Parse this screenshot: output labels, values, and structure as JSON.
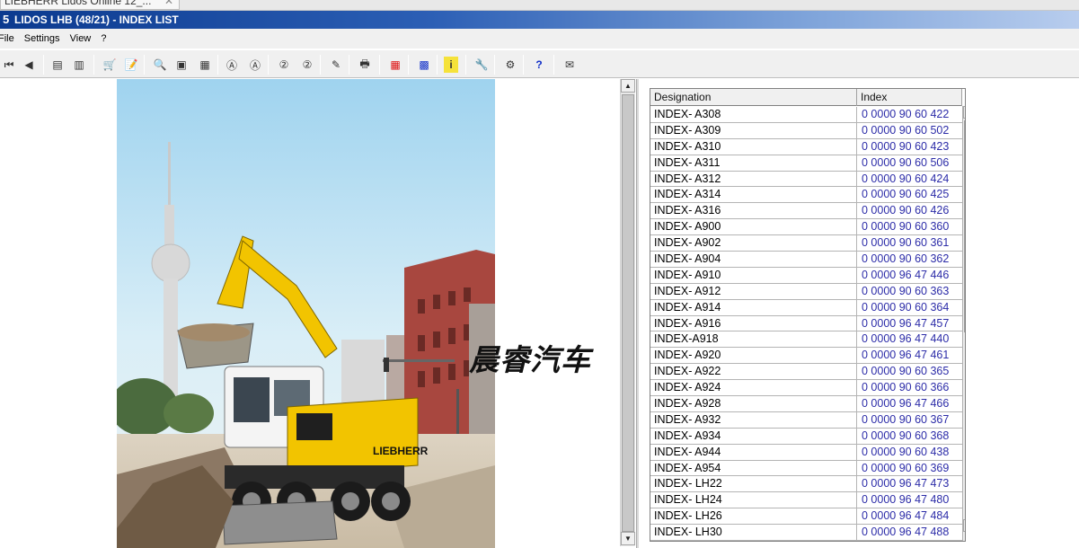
{
  "browser_tab": {
    "label": "LIEBHERR Lidos Online 12_..."
  },
  "window": {
    "title": "LIDOS LHB (48/21) - INDEX LIST",
    "icon": "lidos-app-icon"
  },
  "menu": {
    "items": [
      "File",
      "Settings",
      "View",
      "?"
    ]
  },
  "toolbar": {
    "buttons": [
      {
        "name": "first-page-icon",
        "glyph": "⏮"
      },
      {
        "name": "previous-icon",
        "glyph": "◀"
      },
      {
        "name": "page-back-icon",
        "glyph": "▤"
      },
      {
        "name": "page-forward-icon",
        "glyph": "▥"
      },
      {
        "name": "cart-icon",
        "glyph": "🛒"
      },
      {
        "name": "edit-list-icon",
        "glyph": "📝"
      },
      {
        "name": "zoom-in-icon",
        "glyph": "🔍"
      },
      {
        "name": "fit-page-icon",
        "glyph": "▣"
      },
      {
        "name": "fit-width-icon",
        "glyph": "▦"
      },
      {
        "name": "annotation-a-icon",
        "glyph": "Ⓐ"
      },
      {
        "name": "annotation-a-off-icon",
        "glyph": "Ⓐ"
      },
      {
        "name": "annotation-2-icon",
        "glyph": "②"
      },
      {
        "name": "annotation-2-off-icon",
        "glyph": "②"
      },
      {
        "name": "notes-icon",
        "glyph": "✎"
      },
      {
        "name": "print-icon",
        "glyph": "🖶"
      },
      {
        "name": "grid-icon",
        "glyph": "▦"
      },
      {
        "name": "table-icon",
        "glyph": "▩"
      },
      {
        "name": "info-icon",
        "glyph": "i"
      },
      {
        "name": "tools-icon",
        "glyph": "🔧"
      },
      {
        "name": "parts-icon",
        "glyph": "⚙"
      },
      {
        "name": "lidos-help-icon",
        "glyph": "?"
      },
      {
        "name": "mail-icon",
        "glyph": "✉"
      }
    ]
  },
  "watermark": {
    "text": "晨睿汽车"
  },
  "index_list": {
    "columns": [
      "Designation",
      "Index"
    ],
    "rows": [
      [
        "INDEX- A308",
        "0 0000 90 60 422"
      ],
      [
        "INDEX- A309",
        "0 0000 90 60 502"
      ],
      [
        "INDEX- A310",
        "0 0000 90 60 423"
      ],
      [
        "INDEX- A311",
        "0 0000 90 60 506"
      ],
      [
        "INDEX- A312",
        "0 0000 90 60 424"
      ],
      [
        "INDEX- A314",
        "0 0000 90 60 425"
      ],
      [
        "INDEX- A316",
        "0 0000 90 60 426"
      ],
      [
        "INDEX- A900",
        "0 0000 90 60 360"
      ],
      [
        "INDEX- A902",
        "0 0000 90 60 361"
      ],
      [
        "INDEX- A904",
        "0 0000 90 60 362"
      ],
      [
        "INDEX- A910",
        "0 0000 96 47 446"
      ],
      [
        "INDEX- A912",
        "0 0000 90 60 363"
      ],
      [
        "INDEX- A914",
        "0 0000 90 60 364"
      ],
      [
        "INDEX- A916",
        "0 0000 96 47 457"
      ],
      [
        "INDEX-A918",
        "0 0000 96 47 440"
      ],
      [
        "INDEX- A920",
        "0 0000 96 47 461"
      ],
      [
        "INDEX- A922",
        "0 0000 90 60 365"
      ],
      [
        "INDEX- A924",
        "0 0000 90 60 366"
      ],
      [
        "INDEX- A928",
        "0 0000 96 47 466"
      ],
      [
        "INDEX- A932",
        "0 0000 90 60 367"
      ],
      [
        "INDEX- A934",
        "0 0000 90 60 368"
      ],
      [
        "INDEX- A944",
        "0 0000 90 60 438"
      ],
      [
        "INDEX- A954",
        "0 0000 90 60 369"
      ],
      [
        "INDEX- LH22",
        "0 0000 96 47 473"
      ],
      [
        "INDEX- LH24",
        "0 0000 96 47 480"
      ],
      [
        "INDEX- LH26",
        "0 0000 96 47 484"
      ],
      [
        "INDEX- LH30",
        "0 0000 96 47 488"
      ]
    ]
  },
  "colors": {
    "title_bar": "#0b3a8f",
    "index_link": "#2c2ca8",
    "excavator_yellow": "#f2c400"
  }
}
